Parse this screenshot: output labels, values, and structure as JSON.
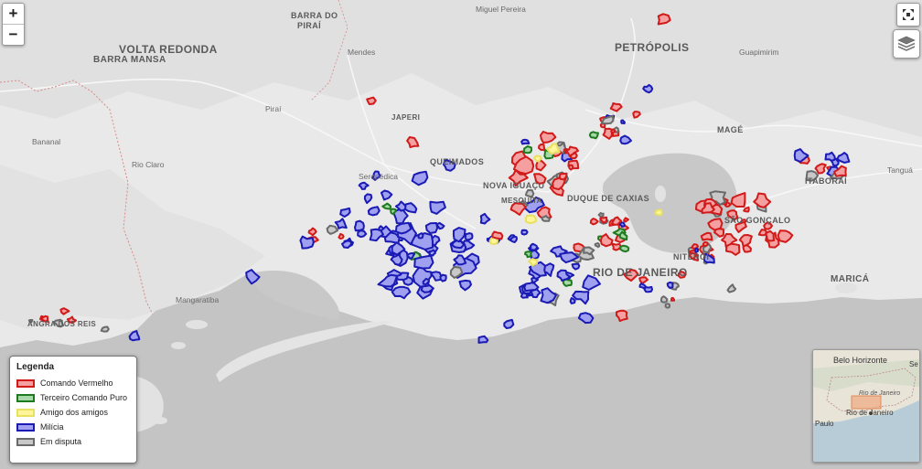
{
  "map": {
    "cities": {
      "volta_redonda": "VOLTA REDONDA",
      "barra_mansa": "BARRA MANSA",
      "barra_do_pirai_1": "BARRA DO",
      "barra_do_pirai_2": "PIRAÍ",
      "petropolis": "PETRÓPOLIS",
      "mage": "MAGÉ",
      "rio_de_janeiro": "RIO DE JANEIRO",
      "marica": "MARICÁ",
      "itaborai": "ITABORAÍ",
      "niteroi": "NITERÓI",
      "queimados": "QUEIMADOS",
      "nova_iguacu": "NOVA IGUAÇU",
      "duque_de_caxias": "DUQUE DE CAXIAS",
      "sao_goncalo": "SÃO GONÇALO",
      "angra": "ANGRA DOS REIS",
      "seropedica": "Seropédica",
      "japeri": "JAPERI",
      "mesquita": "MESQUITA"
    },
    "towns": {
      "miguel_pereira": "Miguel Pereira",
      "mendes": "Mendes",
      "pirai": "Piraí",
      "bananal": "Bananal",
      "rio_claro": "Rio Claro",
      "guapimirim": "Guapimirim",
      "tangua": "Tanguá",
      "mangaratiba": "Mangaratiba"
    }
  },
  "controls": {
    "zoom_in": "+",
    "zoom_out": "−",
    "fullscreen_icon": "fullscreen-icon",
    "layers_icon": "layers-icon"
  },
  "legend": {
    "title": "Legenda",
    "items": [
      {
        "label": "Comando Vermelho",
        "fill": "#f4a0a0",
        "stroke": "#d11a1a"
      },
      {
        "label": "Terceiro Comando Puro",
        "fill": "#a8d8a8",
        "stroke": "#1e7a1e"
      },
      {
        "label": "Amigo dos amigos",
        "fill": "#fff59a",
        "stroke": "#e8e060"
      },
      {
        "label": "Milícia",
        "fill": "#a0a0f0",
        "stroke": "#1a1ab4"
      },
      {
        "label": "Em disputa",
        "fill": "#c8c8c8",
        "stroke": "#6a6a6a"
      }
    ]
  },
  "minimap": {
    "belo_horizonte": "Belo Horizonte",
    "rio_de_janeiro": "Rio de Janeiro",
    "rio_de_janeiro_state": "Rio de Janeiro",
    "sao_paulo": "Paulo",
    "se": "Se"
  }
}
